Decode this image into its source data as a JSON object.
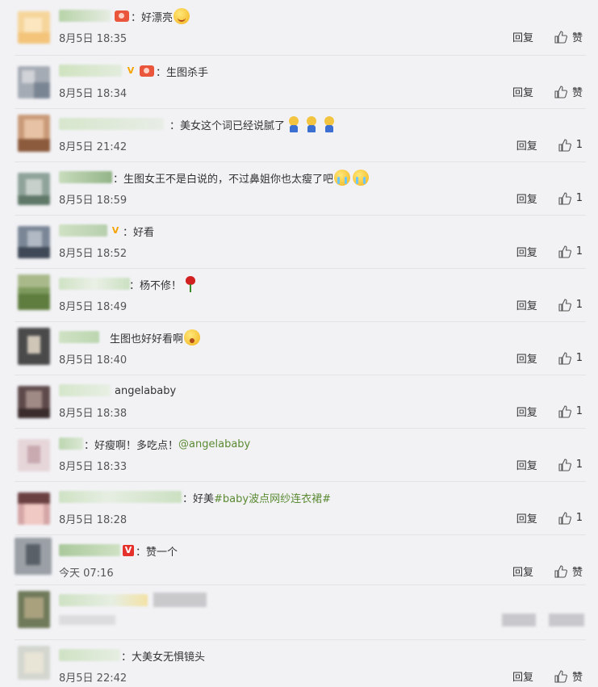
{
  "ui": {
    "reply_label": "回复",
    "like_label": "赞",
    "colon": "："
  },
  "comments": [
    {
      "text": "好漂亮",
      "time": "8月5日 18:35",
      "likes": "赞"
    },
    {
      "text": "生图杀手",
      "time": "8月5日 18:34",
      "likes": "赞"
    },
    {
      "text": "美女这个词已经说腻了",
      "time": "8月5日 21:42",
      "likes": "1"
    },
    {
      "text": "生图女王不是白说的，不过鼻姐你也太瘦了吧",
      "time": "8月5日 18:59",
      "likes": "1"
    },
    {
      "text": "好看",
      "time": "8月5日 18:52",
      "likes": "1"
    },
    {
      "text": "杨不修！",
      "time": "8月5日 18:49",
      "likes": "1"
    },
    {
      "text": "生图也好好看啊",
      "time": "8月5日 18:40",
      "likes": "1"
    },
    {
      "text": "angelababy",
      "time": "8月5日 18:38",
      "likes": "1"
    },
    {
      "text": "好瘦啊！多吃点！",
      "mention": "@angelababy",
      "time": "8月5日 18:33",
      "likes": "1"
    },
    {
      "text": "好美",
      "hashtag": "#baby波点网纱连衣裙#",
      "time": "8月5日 18:28",
      "likes": "1"
    },
    {
      "text": "赞一个",
      "time": "今天 07:16",
      "likes": "赞"
    },
    {
      "text": "",
      "time": "",
      "likes": ""
    },
    {
      "text": "大美女无惧镜头",
      "time": "8月5日 22:42",
      "likes": "赞"
    }
  ],
  "colors": {
    "link": "#5a8a32",
    "vip_gold": "#f4a300",
    "vip_red": "#e5312c",
    "background": "#f2f2f5"
  },
  "icons": {
    "like": "thumbs-up-icon",
    "vip": "v-badge-icon"
  }
}
